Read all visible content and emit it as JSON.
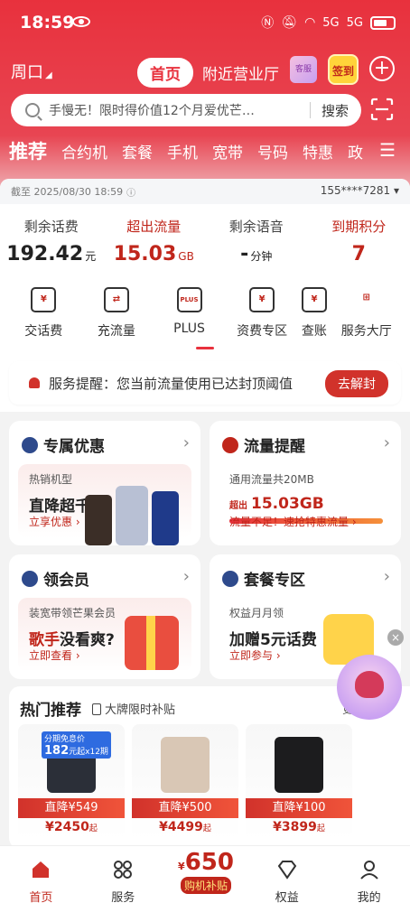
{
  "status_bar": {
    "time": "18:59",
    "net1": "5G",
    "net2": "5G"
  },
  "header": {
    "location": "周口",
    "tab_home": "首页",
    "tab_nearby": "附近营业厅",
    "service_label": "客服",
    "signin_label": "签到"
  },
  "search": {
    "placeholder": "手慢无！限时得价值12个月爱优芒…",
    "button": "搜索"
  },
  "categories": [
    "推荐",
    "合约机",
    "套餐",
    "手机",
    "宽带",
    "号码",
    "特惠",
    "政"
  ],
  "account": {
    "timestamp": "截至 2025/08/30 18:59",
    "phone": "155****7281",
    "stats": [
      {
        "label": "剩余话费",
        "value": "192.42",
        "unit": "元"
      },
      {
        "label": "超出流量",
        "value": "15.03",
        "unit": "GB"
      },
      {
        "label": "剩余语音",
        "value": "-",
        "unit": "分钟"
      },
      {
        "label": "到期积分",
        "value": "7",
        "unit": ""
      }
    ],
    "services": [
      "交话费",
      "充流量",
      "PLUS",
      "资费专区",
      "查账",
      "服务大厅"
    ]
  },
  "notice": {
    "text": "服务提醒：您当前流量使用已达封顶阈值",
    "button": "去解封"
  },
  "cards": {
    "exclusive": {
      "title": "专属优惠",
      "sub": "热销机型",
      "headline": "直降超千元",
      "link": "立享优惠"
    },
    "flow": {
      "title": "流量提醒",
      "sub": "通用流量共20MB",
      "prefix": "超出",
      "value": "15.03GB",
      "link": "流量不足！速抢特惠流量"
    },
    "member": {
      "title": "领会员",
      "sub": "装宽带领芒果会员",
      "headline_red": "歌手",
      "headline": "没看爽?",
      "link": "立即查看"
    },
    "plan": {
      "title": "套餐专区",
      "sub": "权益月月领",
      "headline": "加赠5元话费",
      "link": "立即参与"
    }
  },
  "hot": {
    "title": "热门推荐",
    "subtitle": "大牌限时补贴",
    "more": "更",
    "products": [
      {
        "badge_top": "分期免息价",
        "badge_num": "182",
        "badge_sub": "元起x12期",
        "discount": "直降¥549",
        "price": "¥2450",
        "suffix": "起",
        "color": "#2b2f38"
      },
      {
        "badge_top": "",
        "badge_num": "",
        "badge_sub": "",
        "discount": "直降¥500",
        "price": "¥4499",
        "suffix": "起",
        "color": "#d9c7b5"
      },
      {
        "badge_top": "",
        "badge_num": "",
        "badge_sub": "",
        "discount": "直降¥100",
        "price": "¥3899",
        "suffix": "起",
        "color": "#1c1c1e"
      }
    ]
  },
  "bottom_nav": {
    "home": "首页",
    "service": "服务",
    "center_amount": "650",
    "center_currency": "¥",
    "center_label": "购机补贴",
    "benefits": "权益",
    "mine": "我的"
  },
  "colors": {
    "brand_red": "#e8313d",
    "accent_red": "#c0261b"
  }
}
